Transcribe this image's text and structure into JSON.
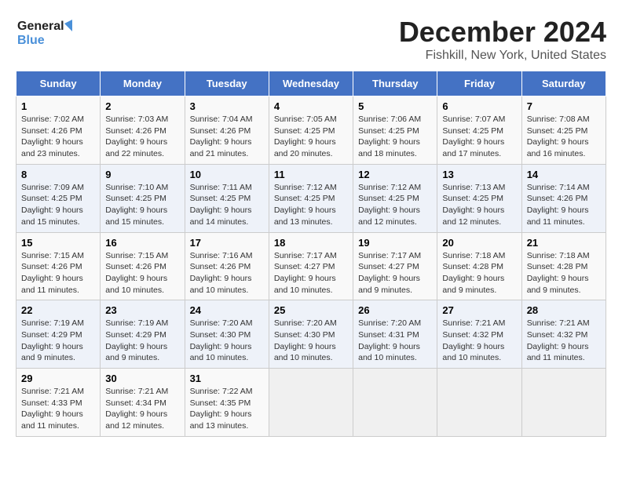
{
  "header": {
    "logo_line1": "General",
    "logo_line2": "Blue",
    "main_title": "December 2024",
    "subtitle": "Fishkill, New York, United States"
  },
  "days_of_week": [
    "Sunday",
    "Monday",
    "Tuesday",
    "Wednesday",
    "Thursday",
    "Friday",
    "Saturday"
  ],
  "weeks": [
    [
      {
        "day": "1",
        "sunrise": "7:02 AM",
        "sunset": "4:26 PM",
        "daylight": "9 hours and 23 minutes."
      },
      {
        "day": "2",
        "sunrise": "7:03 AM",
        "sunset": "4:26 PM",
        "daylight": "9 hours and 22 minutes."
      },
      {
        "day": "3",
        "sunrise": "7:04 AM",
        "sunset": "4:26 PM",
        "daylight": "9 hours and 21 minutes."
      },
      {
        "day": "4",
        "sunrise": "7:05 AM",
        "sunset": "4:25 PM",
        "daylight": "9 hours and 20 minutes."
      },
      {
        "day": "5",
        "sunrise": "7:06 AM",
        "sunset": "4:25 PM",
        "daylight": "9 hours and 18 minutes."
      },
      {
        "day": "6",
        "sunrise": "7:07 AM",
        "sunset": "4:25 PM",
        "daylight": "9 hours and 17 minutes."
      },
      {
        "day": "7",
        "sunrise": "7:08 AM",
        "sunset": "4:25 PM",
        "daylight": "9 hours and 16 minutes."
      }
    ],
    [
      {
        "day": "8",
        "sunrise": "7:09 AM",
        "sunset": "4:25 PM",
        "daylight": "9 hours and 15 minutes."
      },
      {
        "day": "9",
        "sunrise": "7:10 AM",
        "sunset": "4:25 PM",
        "daylight": "9 hours and 15 minutes."
      },
      {
        "day": "10",
        "sunrise": "7:11 AM",
        "sunset": "4:25 PM",
        "daylight": "9 hours and 14 minutes."
      },
      {
        "day": "11",
        "sunrise": "7:12 AM",
        "sunset": "4:25 PM",
        "daylight": "9 hours and 13 minutes."
      },
      {
        "day": "12",
        "sunrise": "7:12 AM",
        "sunset": "4:25 PM",
        "daylight": "9 hours and 12 minutes."
      },
      {
        "day": "13",
        "sunrise": "7:13 AM",
        "sunset": "4:25 PM",
        "daylight": "9 hours and 12 minutes."
      },
      {
        "day": "14",
        "sunrise": "7:14 AM",
        "sunset": "4:26 PM",
        "daylight": "9 hours and 11 minutes."
      }
    ],
    [
      {
        "day": "15",
        "sunrise": "7:15 AM",
        "sunset": "4:26 PM",
        "daylight": "9 hours and 11 minutes."
      },
      {
        "day": "16",
        "sunrise": "7:15 AM",
        "sunset": "4:26 PM",
        "daylight": "9 hours and 10 minutes."
      },
      {
        "day": "17",
        "sunrise": "7:16 AM",
        "sunset": "4:26 PM",
        "daylight": "9 hours and 10 minutes."
      },
      {
        "day": "18",
        "sunrise": "7:17 AM",
        "sunset": "4:27 PM",
        "daylight": "9 hours and 10 minutes."
      },
      {
        "day": "19",
        "sunrise": "7:17 AM",
        "sunset": "4:27 PM",
        "daylight": "9 hours and 9 minutes."
      },
      {
        "day": "20",
        "sunrise": "7:18 AM",
        "sunset": "4:28 PM",
        "daylight": "9 hours and 9 minutes."
      },
      {
        "day": "21",
        "sunrise": "7:18 AM",
        "sunset": "4:28 PM",
        "daylight": "9 hours and 9 minutes."
      }
    ],
    [
      {
        "day": "22",
        "sunrise": "7:19 AM",
        "sunset": "4:29 PM",
        "daylight": "9 hours and 9 minutes."
      },
      {
        "day": "23",
        "sunrise": "7:19 AM",
        "sunset": "4:29 PM",
        "daylight": "9 hours and 9 minutes."
      },
      {
        "day": "24",
        "sunrise": "7:20 AM",
        "sunset": "4:30 PM",
        "daylight": "9 hours and 10 minutes."
      },
      {
        "day": "25",
        "sunrise": "7:20 AM",
        "sunset": "4:30 PM",
        "daylight": "9 hours and 10 minutes."
      },
      {
        "day": "26",
        "sunrise": "7:20 AM",
        "sunset": "4:31 PM",
        "daylight": "9 hours and 10 minutes."
      },
      {
        "day": "27",
        "sunrise": "7:21 AM",
        "sunset": "4:32 PM",
        "daylight": "9 hours and 10 minutes."
      },
      {
        "day": "28",
        "sunrise": "7:21 AM",
        "sunset": "4:32 PM",
        "daylight": "9 hours and 11 minutes."
      }
    ],
    [
      {
        "day": "29",
        "sunrise": "7:21 AM",
        "sunset": "4:33 PM",
        "daylight": "9 hours and 11 minutes."
      },
      {
        "day": "30",
        "sunrise": "7:21 AM",
        "sunset": "4:34 PM",
        "daylight": "9 hours and 12 minutes."
      },
      {
        "day": "31",
        "sunrise": "7:22 AM",
        "sunset": "4:35 PM",
        "daylight": "9 hours and 13 minutes."
      },
      null,
      null,
      null,
      null
    ]
  ],
  "labels": {
    "sunrise": "Sunrise:",
    "sunset": "Sunset:",
    "daylight": "Daylight:"
  }
}
